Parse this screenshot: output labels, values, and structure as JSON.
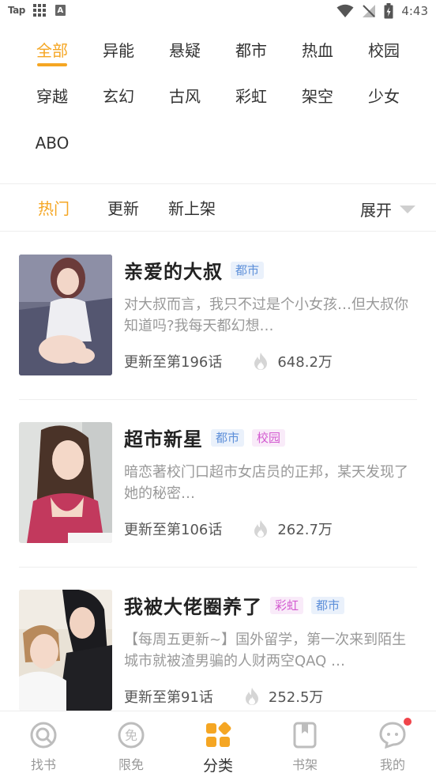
{
  "status_bar": {
    "carrier_label": "Tap",
    "a_label": "A",
    "time": "4:43"
  },
  "genres": [
    "全部",
    "异能",
    "悬疑",
    "都市",
    "热血",
    "校园",
    "穿越",
    "玄幻",
    "古风",
    "彩虹",
    "架空",
    "少女",
    "ABO"
  ],
  "active_genre": "全部",
  "sort": {
    "options": [
      "热门",
      "更新",
      "新上架"
    ],
    "active": "热门",
    "expand_label": "展开"
  },
  "comics": [
    {
      "title": "亲爱的大叔",
      "tags": [
        {
          "label": "都市",
          "color": "blue"
        }
      ],
      "description": "对大叔而言，我只不过是个小女孩…但大叔你知道吗?我每天都幻想…",
      "update": "更新至第196话",
      "heat": "648.2万"
    },
    {
      "title": "超市新星",
      "tags": [
        {
          "label": "都市",
          "color": "blue"
        },
        {
          "label": "校园",
          "color": "pink"
        }
      ],
      "description": "暗恋著校门口超市女店员的正邦，某天发现了她的秘密…",
      "update": "更新至第106话",
      "heat": "262.7万"
    },
    {
      "title": "我被大佬圈养了",
      "tags": [
        {
          "label": "彩虹",
          "color": "pink"
        },
        {
          "label": "都市",
          "color": "blue"
        }
      ],
      "description": "【每周五更新~】国外留学，第一次来到陌生城市就被渣男骗的人财两空QAQ …",
      "update": "更新至第91话",
      "heat": "252.5万"
    }
  ],
  "bottom_nav": [
    {
      "label": "找书",
      "icon": "search-book-icon"
    },
    {
      "label": "限免",
      "icon": "free-icon",
      "icon_glyph": "免"
    },
    {
      "label": "分类",
      "icon": "category-icon",
      "active": true
    },
    {
      "label": "书架",
      "icon": "bookshelf-icon"
    },
    {
      "label": "我的",
      "icon": "profile-chat-icon",
      "has_badge": true
    }
  ],
  "colors": {
    "accent": "#f5a623",
    "tag_blue": "#5d8fd9",
    "tag_pink": "#d35ad0",
    "badge_red": "#f0444a"
  }
}
